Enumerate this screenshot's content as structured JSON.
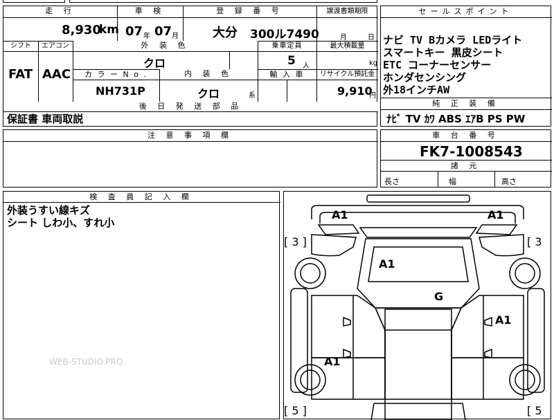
{
  "header": {
    "mileage_label": "走 行",
    "inspection_label": "車 検",
    "registration_label": "登 録 番 号",
    "transfer_label": "譲渡書類期限",
    "selling_points_label": "セールスポイント"
  },
  "values": {
    "mileage": "8,930",
    "mileage_unit": "km",
    "inspection_year": "07",
    "inspection_year_unit": "年",
    "inspection_month": "07",
    "inspection_month_unit": "月",
    "registration_region": "大分",
    "registration_number": "300ル7490",
    "transfer_month_unit": "月",
    "transfer_day_unit": "日"
  },
  "row2": {
    "shift_label": "シフト",
    "aircon_label": "エアコン",
    "exterior_color_label": "外 装 色",
    "capacity_label": "乗車定員",
    "max_load_label": "最大積載量",
    "shift": "FAT",
    "aircon": "AAC",
    "exterior_color": "クロ",
    "capacity": "5",
    "capacity_unit": "人",
    "max_load_unit": "kg",
    "color_no_label": "カ ラ ー N o .",
    "interior_color_label": "内 装 色",
    "import_label": "輸 入 車",
    "recycle_label": "リサイクル預託金",
    "color_no": "NH731P",
    "interior_color": "クロ",
    "interior_color_unit": "系",
    "recycle_fee": "9,910",
    "recycle_unit": "円"
  },
  "selling_points": {
    "lines": [
      "ナビ TV Bカメラ LEDライト",
      "スマートキー 黒皮シート",
      "ETC コーナーセンサー",
      "ホンダセンシング",
      "外18インチAW"
    ]
  },
  "later_parts": {
    "label": "後 日 発 送 部 品",
    "value": "保証書 車両取説"
  },
  "genuine_equipment": {
    "label": "純 正 装 備",
    "value": "ﾅﾋﾞ TV ｶﾜ ABS ｴｱB PS PW"
  },
  "caution": {
    "label": "注 意 事 項 欄"
  },
  "chassis": {
    "label": "車 台 番 号",
    "value": "FK7-1008543",
    "dims_label": "諸 元",
    "length_label": "長さ",
    "width_label": "幅",
    "height_label": "高さ"
  },
  "inspector": {
    "label": "検 査 員 記 入 欄",
    "lines": [
      "外装うすい線キズ",
      "シート しわ小、すれ小"
    ]
  },
  "diagram": {
    "marks": {
      "front_left": "A1",
      "front_right": "A1",
      "hood": "A1",
      "roof": "G",
      "right_door": "A1",
      "left_door": "A1"
    },
    "tire_labels": {
      "front_left": "[ 3 ]",
      "front_right": "[ 3",
      "rear_left": "[ 5 ]",
      "rear_right": "[ 5"
    }
  },
  "watermark": "WEB-STUDIO.PRO"
}
